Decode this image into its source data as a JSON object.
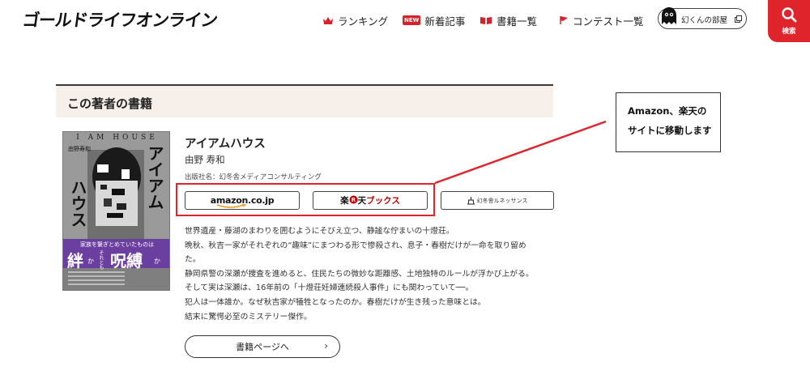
{
  "header": {
    "logo_text": "ゴールドライフオンライン",
    "nav": [
      {
        "label": "ランキング"
      },
      {
        "label": "新着記事",
        "badge": "NEW"
      },
      {
        "label": "書籍一覧"
      },
      {
        "label": "コンテスト一覧"
      }
    ],
    "room_label": "幻くんの部屋",
    "search_label": "検索"
  },
  "section": {
    "title": "この著者の書籍"
  },
  "book": {
    "title": "アイアムハウス",
    "author": "由野 寿和",
    "publisher": "出版社名：幻冬舎メディアコンサルティング",
    "cover": {
      "top_text": "I AM HOUSE",
      "author": "由野寿和",
      "title_vertical_right": "アイアム",
      "title_vertical_left": "ハウス",
      "tagline": "家族を繋ぎとめていたものは",
      "big_left": "絆",
      "big_right": "呪縛",
      "small_ka1": "か",
      "small_ka2": "か",
      "small_sore": "それとも"
    },
    "stores": {
      "amazon": "amazon.co.jp",
      "rakuten_prefix": "楽",
      "rakuten_suffix": "天",
      "rakuten_books": "ブックス",
      "gentosha": "幻冬舎ルネッサンス"
    },
    "description": [
      "世界遺産・藤湖のまわりを囲むようにそびえ立つ、静謐な佇まいの十燈荘。",
      "晩秋、秋吉一家がそれぞれの“趣味”にまつわる形で惨殺され、息子・春樹だけが一命を取り留め",
      "た。",
      "静岡県警の深瀬が捜査を進めると、住民たちの微妙な距離感、土地独特のルールが浮かび上がる。",
      "そして実は深瀬は、16年前の「十燈荘妊婦連続殺人事件」にも関わっていて──。",
      "犯人は一体誰か。なぜ秋吉家が犠牲となったのか。春樹だけが生き残った意味とは。",
      "結末に驚愕必至のミステリー傑作。"
    ],
    "book_page_button": "書籍ページへ",
    "book_page_arrow": "›"
  },
  "callout": {
    "line1": "Amazon、楽天の",
    "line2": "サイトに移動します"
  },
  "colors": {
    "accent": "#e0242b",
    "section_bg": "#f7f0ea",
    "cover_purple": "#6b3fa0"
  }
}
